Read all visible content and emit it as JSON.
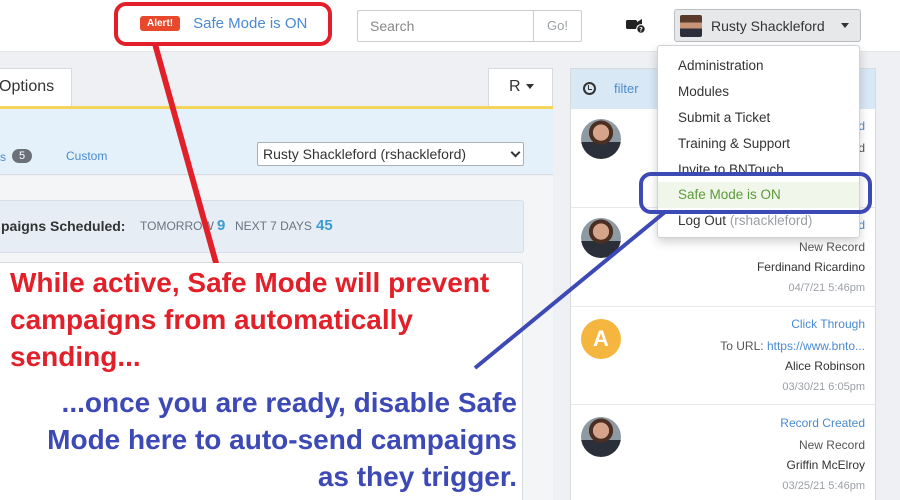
{
  "header": {
    "alert_badge": "Alert!",
    "alert_text": "Safe Mode is ON",
    "search": {
      "placeholder": "Search",
      "go_label": "Go!"
    },
    "help_icon": "camera-help-icon",
    "user": {
      "name": "Rusty Shackleford"
    }
  },
  "left_panel": {
    "tab_options": "Options",
    "tab_r": "R",
    "filter": {
      "partial_label": "s",
      "count": "5",
      "custom_label": "Custom",
      "user_select": "Rusty Shackleford (rshackleford)"
    },
    "scheduled": {
      "label": "paigns Scheduled:",
      "tomorrow_label": "TOMORROW",
      "tomorrow_value": "9",
      "next7_label": "NEXT 7 DAYS",
      "next7_value": "45"
    }
  },
  "feed": {
    "filter_label": "filter",
    "items": [
      {
        "action": "d",
        "subtitle": "d",
        "name": "",
        "date": ""
      },
      {
        "action": "d",
        "subtitle": "New Record",
        "name": "Ferdinand Ricardino",
        "date": "04/7/21 5:46pm"
      },
      {
        "avatar_letter": "A",
        "action": "Click Through",
        "url_label": "To URL:",
        "url": "https://www.bnto...",
        "name": "Alice Robinson",
        "date": "03/30/21 6:05pm"
      },
      {
        "action": "Record Created",
        "subtitle": "New Record",
        "name": "Griffin McElroy",
        "date": "03/25/21 5:46pm"
      }
    ]
  },
  "dropdown": {
    "items": [
      {
        "label": "Administration"
      },
      {
        "label": "Modules"
      },
      {
        "label": "Submit a Ticket"
      },
      {
        "label": "Training & Support"
      },
      {
        "label": "Invite to BNTouch"
      },
      {
        "label": "Safe Mode is ON"
      },
      {
        "label": "Log Out",
        "muted": "(rshackleford)"
      }
    ]
  },
  "annotations": {
    "red_text": "While active, Safe Mode will prevent campaigns from automatically sending...",
    "blue_text": "...once you are ready, disable Safe Mode here to auto-send campaigns as they trigger.",
    "red_color": "#e2202a",
    "blue_color": "#3d4ab5"
  }
}
